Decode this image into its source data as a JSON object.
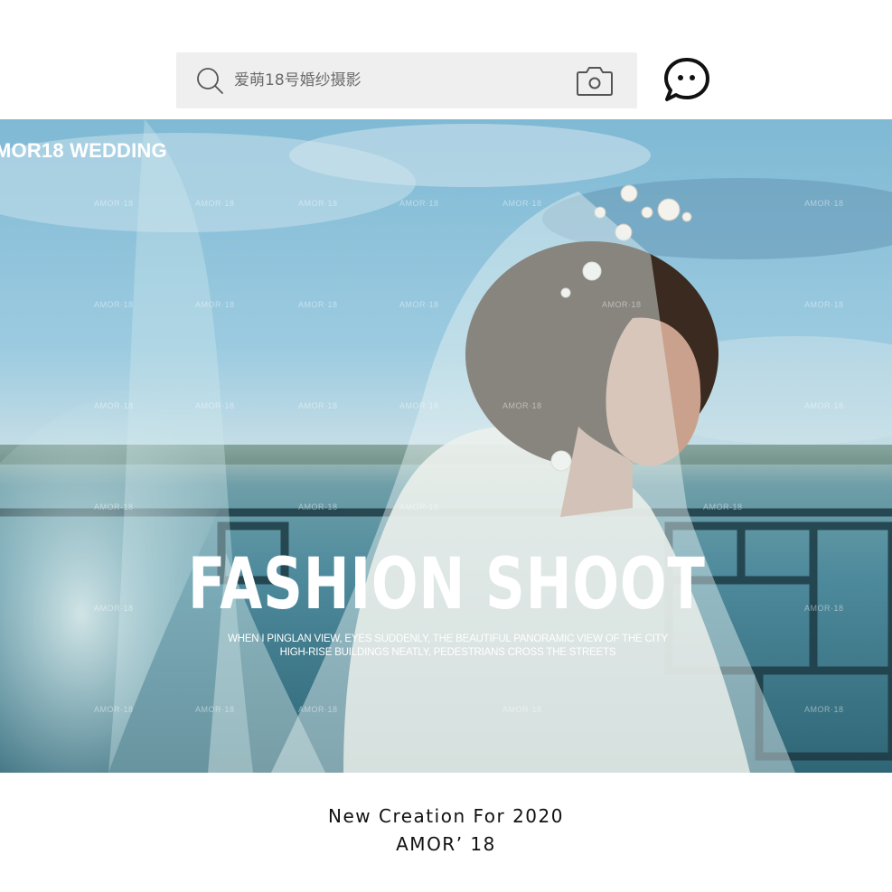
{
  "search": {
    "placeholder": "爱萌18号婚纱摄影",
    "search_icon": "search-icon",
    "camera_icon": "camera-icon"
  },
  "header": {
    "message_icon": "chat-bubble-icon"
  },
  "hero": {
    "brand_tag": "MOR18  WEDDING",
    "headline": "FASHION SHOOT",
    "subline_1": "WHEN I PINGLAN VIEW, EYES SUDDENLY, THE BEAUTIFUL PANORAMIC VIEW OF THE CITY",
    "subline_2": "HIGH-RISE BUILDINGS NEATLY, PEDESTRIANS CROSS THE STREETS",
    "watermark": "AMOR·18"
  },
  "footer": {
    "line_1": "New Creation For 2020",
    "line_2": "AMOR’ 18"
  },
  "colors": {
    "search_bg": "#efefef",
    "sky": "#8fc3d9",
    "sea": "#3a7485",
    "text_dark": "#111111"
  }
}
